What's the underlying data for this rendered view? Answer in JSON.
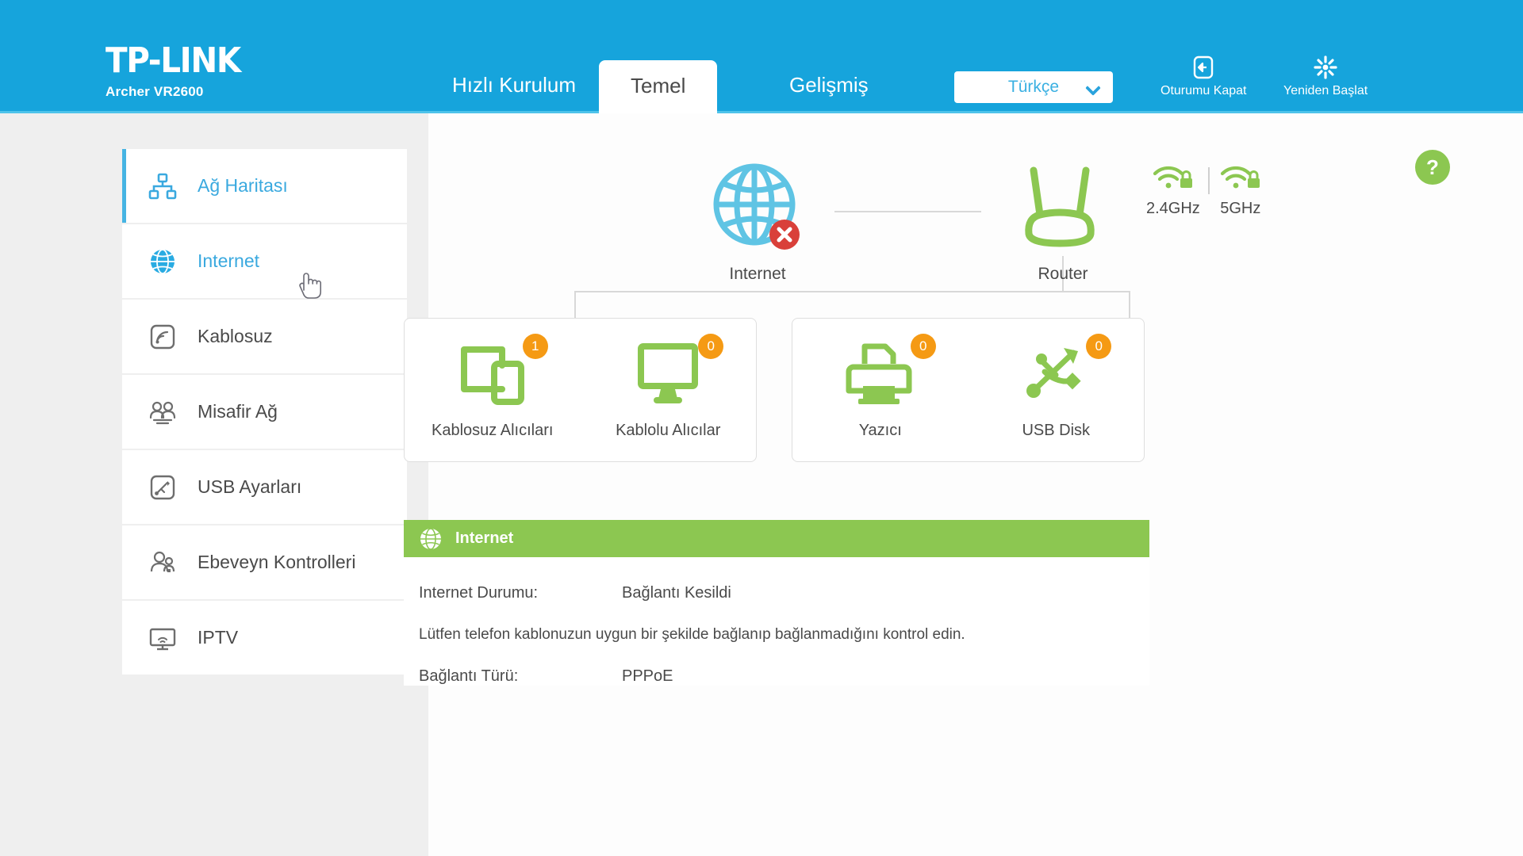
{
  "header": {
    "brand": "TP-LINK",
    "model": "Archer VR2600",
    "tabs": [
      {
        "label": "Hızlı Kurulum",
        "active": false
      },
      {
        "label": "Temel",
        "active": true
      },
      {
        "label": "Gelişmiş",
        "active": false
      }
    ],
    "language": {
      "selected": "Türkçe",
      "icon": "chevron-down-icon"
    },
    "actions": [
      {
        "label": "Oturumu Kapat",
        "icon": "logout-icon"
      },
      {
        "label": "Yeniden Başlat",
        "icon": "reboot-icon"
      }
    ]
  },
  "sidebar": {
    "items": [
      {
        "label": "Ağ Haritası",
        "icon": "network-map-icon",
        "state": "active"
      },
      {
        "label": "Internet",
        "icon": "globe-icon",
        "state": "hover"
      },
      {
        "label": "Kablosuz",
        "icon": "wireless-icon",
        "state": "normal"
      },
      {
        "label": "Misafir Ağ",
        "icon": "guest-network-icon",
        "state": "normal"
      },
      {
        "label": "USB Ayarları",
        "icon": "usb-settings-icon",
        "state": "normal"
      },
      {
        "label": "Ebeveyn Kontrolleri",
        "icon": "parental-control-icon",
        "state": "normal"
      },
      {
        "label": "IPTV",
        "icon": "iptv-icon",
        "state": "normal"
      }
    ]
  },
  "content": {
    "help_button": {
      "label": "?",
      "icon": "help-icon"
    },
    "topology": {
      "internet": {
        "label": "Internet",
        "icon": "globe-wireframe-icon",
        "status_badge": "error"
      },
      "router": {
        "label": "Router",
        "icon": "router-icon"
      },
      "wifi_bands": [
        {
          "label": "2.4GHz",
          "icon": "wifi-lock-icon",
          "secured": true
        },
        {
          "label": "5GHz",
          "icon": "wifi-lock-icon",
          "secured": true
        }
      ]
    },
    "device_groups": [
      {
        "name": "clients",
        "cards": [
          {
            "label": "Kablosuz Alıcıları",
            "count": "1",
            "icon": "wireless-clients-icon"
          },
          {
            "label": "Kablolu Alıcılar",
            "count": "0",
            "icon": "wired-clients-icon"
          }
        ]
      },
      {
        "name": "usb",
        "cards": [
          {
            "label": "Yazıcı",
            "count": "0",
            "icon": "printer-icon"
          },
          {
            "label": "USB Disk",
            "count": "0",
            "icon": "usb-disk-icon"
          }
        ]
      }
    ],
    "internet_panel": {
      "title": "Internet",
      "icon": "globe-filled-icon",
      "status_label": "Internet Durumu:",
      "status_value": "Bağlantı Kesildi",
      "note": "Lütfen telefon kablonuzun uygun bir şekilde bağlanıp bağlanmadığını kontrol edin.",
      "conn_type_label": "Bağlantı Türü:",
      "conn_type_value": "PPPoE"
    }
  },
  "colors": {
    "header_blue": "#16a4dc",
    "accent_blue": "#3aa9df",
    "green": "#8cc751",
    "badge_orange": "#f59a14",
    "error_red": "#d9403a"
  }
}
